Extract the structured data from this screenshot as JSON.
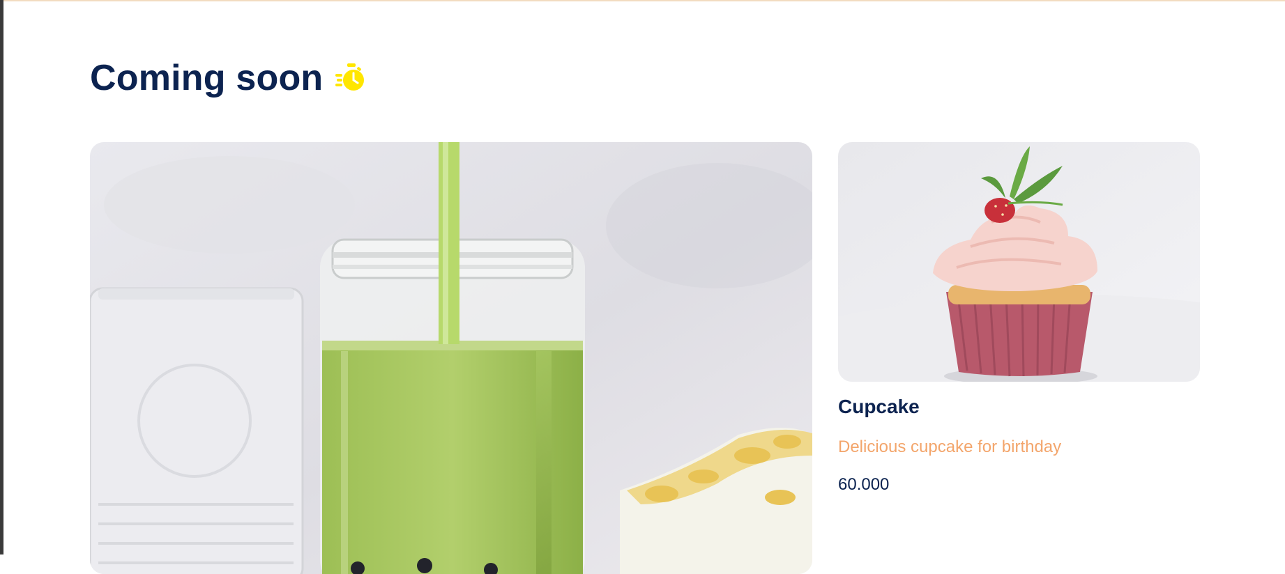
{
  "section": {
    "title": "Coming soon",
    "title_icon": "stopwatch-icon",
    "colors": {
      "title": "#0c2350",
      "icon": "#ffe600",
      "description": "#f3a56b",
      "price": "#0c2350",
      "top_border": "#f2dcc0"
    }
  },
  "featured": {
    "image_semantic": "green-smoothie-jar-image"
  },
  "products": [
    {
      "image_semantic": "strawberry-cupcake-image",
      "name": "Cupcake",
      "description": "Delicious cupcake for birthday",
      "price": "60.000"
    }
  ]
}
